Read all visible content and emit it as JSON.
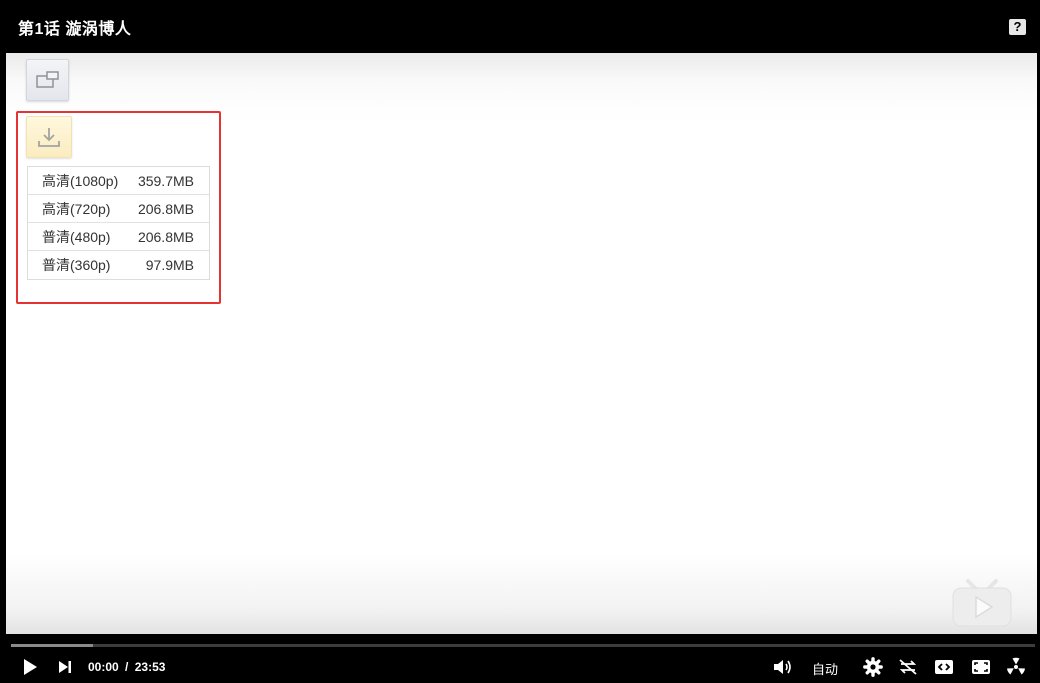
{
  "header": {
    "title": "第1话 漩涡博人",
    "help_glyph": "?"
  },
  "video": {
    "pip_icon": "picture-in-picture-icon",
    "download_icon": "download-icon",
    "download_options": [
      {
        "quality": "高清(1080p)",
        "size": "359.7MB"
      },
      {
        "quality": "高清(720p)",
        "size": "206.8MB"
      },
      {
        "quality": "普清(480p)",
        "size": "206.8MB"
      },
      {
        "quality": "普清(360p)",
        "size": "97.9MB"
      }
    ],
    "logo_icon": "tv-play-logo-icon",
    "panel_highlight_color": "#e53232"
  },
  "controls": {
    "current_time": "00:00",
    "separator": "/",
    "duration": "23:53",
    "progress_fraction": 0.08,
    "quality_label": "自动",
    "icons": [
      "play-icon",
      "next-icon",
      "volume-icon",
      "settings-icon",
      "rotate-icon",
      "widescreen-icon",
      "fullscreen-icon",
      "fan-icon"
    ]
  }
}
